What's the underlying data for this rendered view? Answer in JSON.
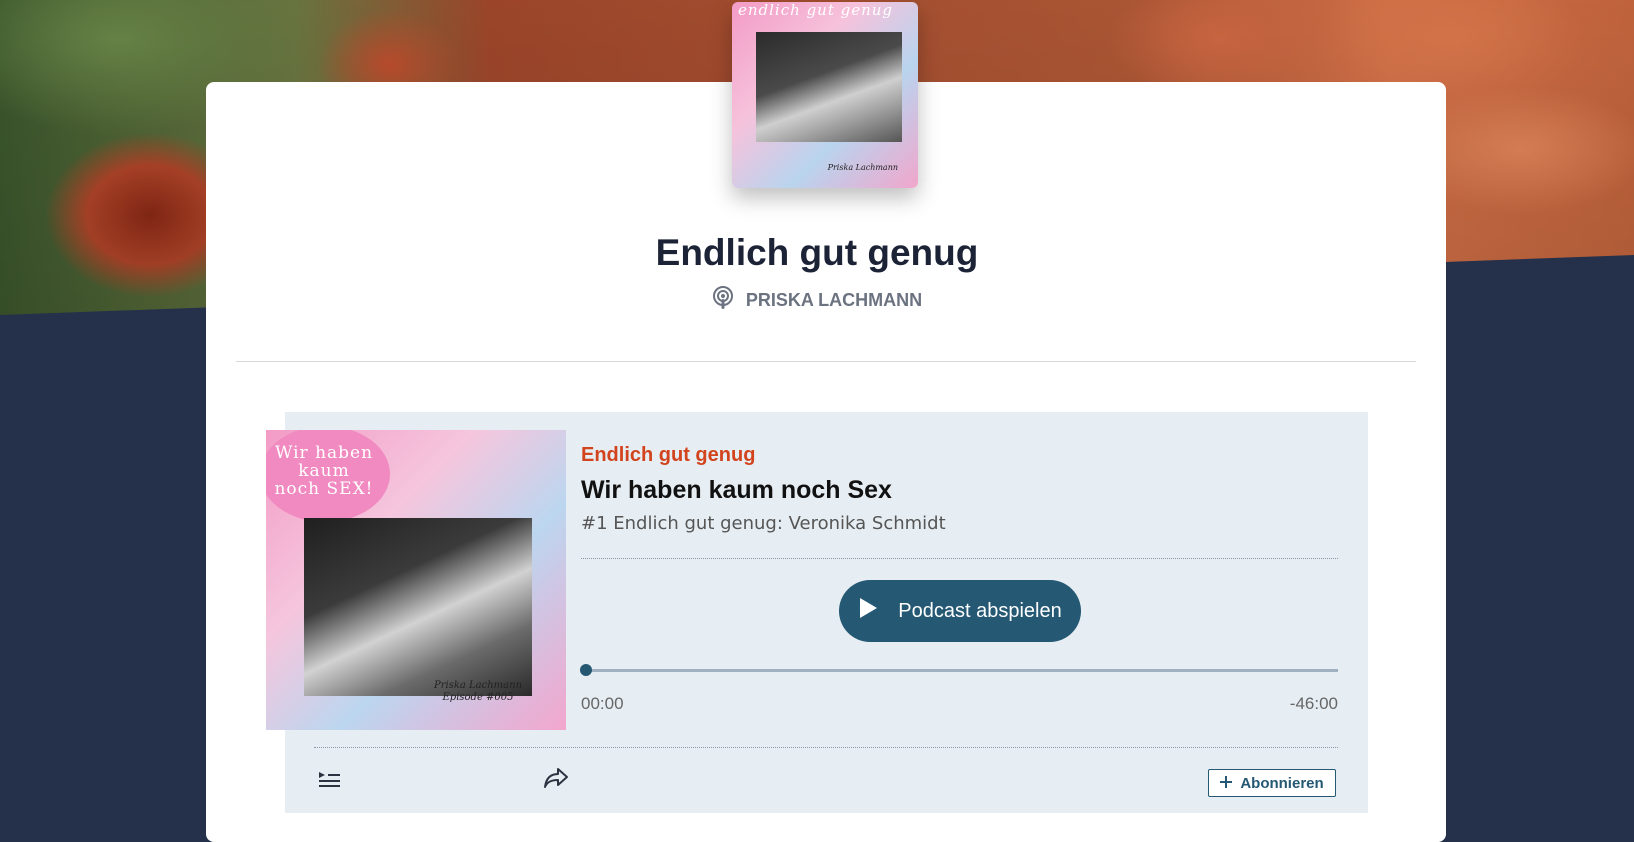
{
  "podcast": {
    "title": "Endlich gut genug",
    "author": "PRISKA LACHMANN",
    "cover_script": "endlich gut genug",
    "cover_signature": "Priska Lachmann"
  },
  "episode": {
    "show_name": "Endlich gut genug",
    "title": "Wir haben kaum noch Sex",
    "subtitle": "#1 Endlich gut genug: Veronika Schmidt",
    "art_bubble_text": "Wir haben kaum noch SEX!",
    "art_signature": "Priska Lachmann",
    "art_episode": "Episode #005"
  },
  "player": {
    "play_label": "Podcast abspielen",
    "time_elapsed": "00:00",
    "time_remaining": "-46:00",
    "progress": 0
  },
  "actions": {
    "subscribe_label": "Abonnieren"
  },
  "icons": [
    "podcast-icon",
    "play-icon",
    "playlist-icon",
    "share-icon",
    "plus-icon"
  ],
  "colors": {
    "accent": "#245873",
    "show_name": "#d2441d",
    "player_bg": "#e7eef3",
    "page_bg": "#25304a"
  }
}
